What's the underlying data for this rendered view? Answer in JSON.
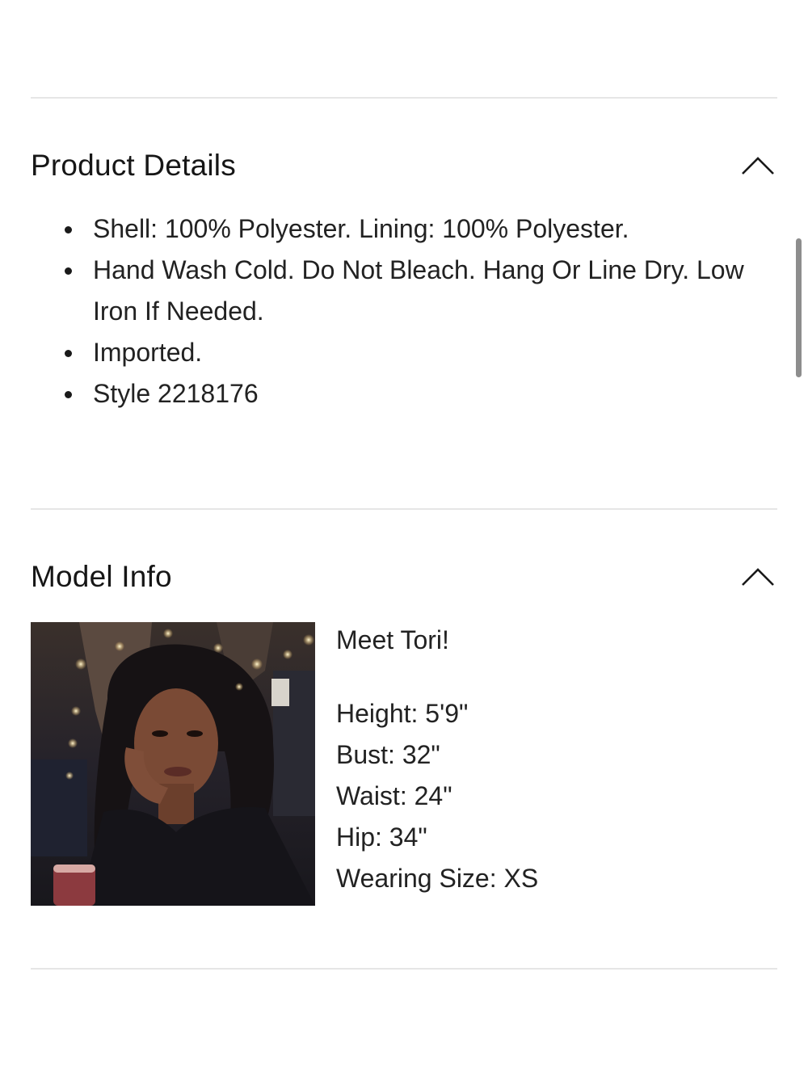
{
  "product_details": {
    "title": "Product Details",
    "chevron_icon": "chevron-up-icon",
    "items": [
      "Shell: 100% Polyester. Lining: 100% Polyester.",
      "Hand Wash Cold. Do Not Bleach. Hang Or Line Dry. Low Iron If Needed.",
      "Imported.",
      "Style 2218176"
    ]
  },
  "model_info": {
    "title": "Model Info",
    "chevron_icon": "chevron-up-icon",
    "photo_icon": "model-photo",
    "intro": "Meet Tori!",
    "stats": [
      "Height: 5'9\"",
      "Bust: 32\"",
      "Waist: 24\"",
      "Hip: 34\"",
      "Wearing Size: XS"
    ]
  },
  "colors": {
    "text": "#1a1a1a",
    "divider": "#e6e6e6",
    "scrollbar": "#8d8d8d"
  }
}
